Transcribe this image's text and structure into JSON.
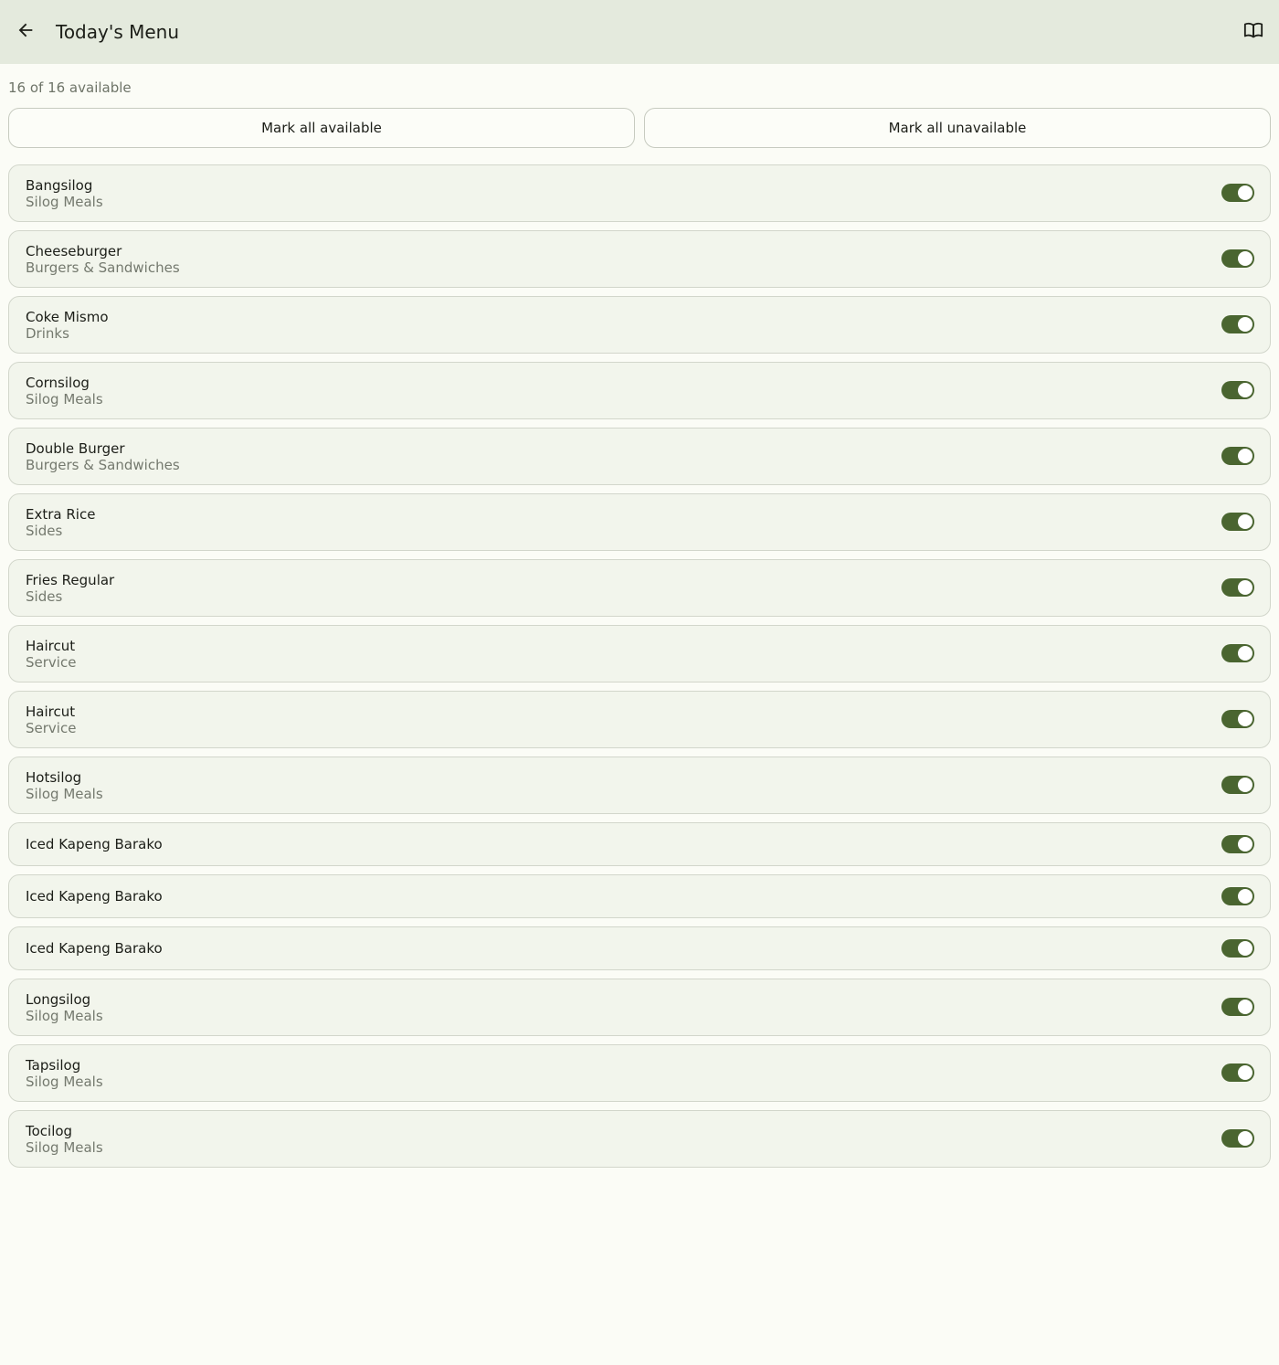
{
  "appbar": {
    "title": "Today's Menu",
    "back_icon": "arrow-left-icon",
    "menu_icon": "open-book-icon"
  },
  "summary": "16 of 16 available",
  "actions": {
    "mark_all_available": "Mark all available",
    "mark_all_unavailable": "Mark all unavailable"
  },
  "colors": {
    "appbar_bg": "#e4eadd",
    "page_bg": "#fbfcf6",
    "toggle_on": "#4a6530"
  },
  "items": [
    {
      "name": "Bangsilog",
      "category": "Silog Meals",
      "available": true
    },
    {
      "name": "Cheeseburger",
      "category": "Burgers & Sandwiches",
      "available": true
    },
    {
      "name": "Coke Mismo",
      "category": "Drinks",
      "available": true
    },
    {
      "name": "Cornsilog",
      "category": "Silog Meals",
      "available": true
    },
    {
      "name": "Double Burger",
      "category": "Burgers & Sandwiches",
      "available": true
    },
    {
      "name": "Extra Rice",
      "category": "Sides",
      "available": true
    },
    {
      "name": "Fries Regular",
      "category": "Sides",
      "available": true
    },
    {
      "name": "Haircut",
      "category": "Service",
      "available": true
    },
    {
      "name": "Haircut",
      "category": "Service",
      "available": true
    },
    {
      "name": "Hotsilog",
      "category": "Silog Meals",
      "available": true
    },
    {
      "name": "Iced Kapeng Barako",
      "category": "",
      "available": true
    },
    {
      "name": "Iced Kapeng Barako",
      "category": "",
      "available": true
    },
    {
      "name": "Iced Kapeng Barako",
      "category": "",
      "available": true
    },
    {
      "name": "Longsilog",
      "category": "Silog Meals",
      "available": true
    },
    {
      "name": "Tapsilog",
      "category": "Silog Meals",
      "available": true
    },
    {
      "name": "Tocilog",
      "category": "Silog Meals",
      "available": true
    }
  ]
}
